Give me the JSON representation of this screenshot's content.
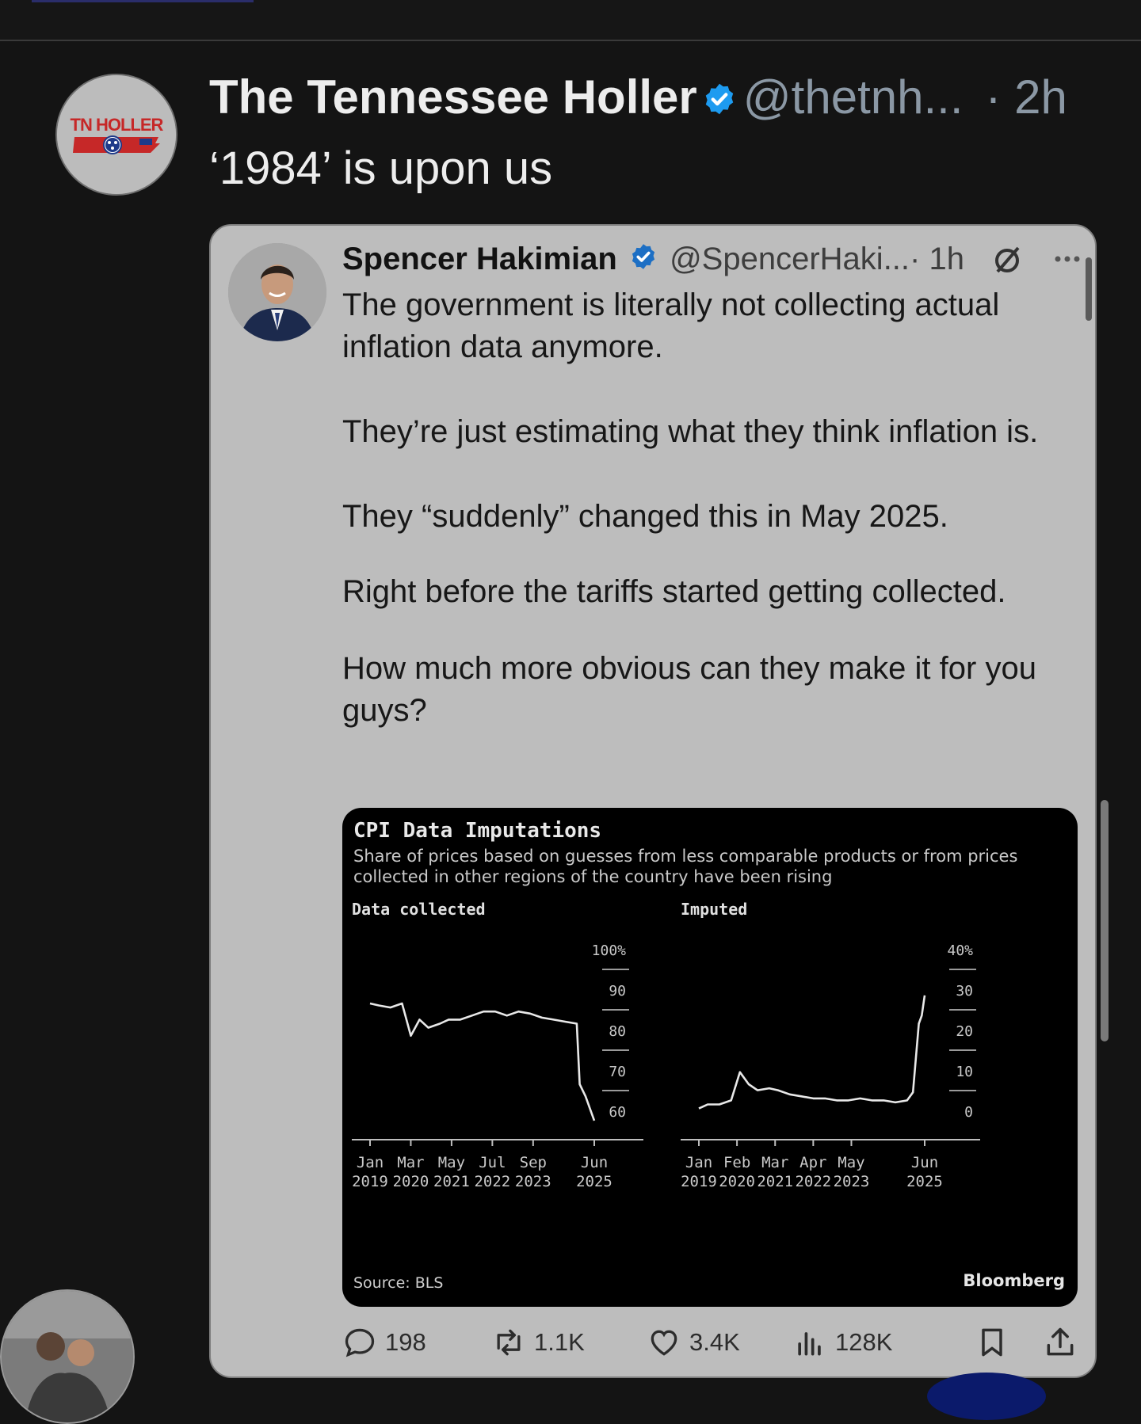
{
  "tweet": {
    "display_name": "The Tennessee Holler",
    "handle": "@thetnh...",
    "time": "· 2h",
    "text": "‘1984’ is upon us",
    "avatar_logo_text": "TN HOLLER"
  },
  "quote": {
    "display_name": "Spencer Hakimian",
    "handle": "@SpencerHaki...",
    "time": "· 1h",
    "paragraphs": [
      "The government is literally not collecting actual inflation data anymore.",
      "They’re just estimating what they think inflation is.",
      "They “suddenly” changed this in May 2025.",
      "Right before the tariffs started getting collected.",
      "How much more obvious can they make it for you guys?"
    ]
  },
  "chart": {
    "title": "CPI Data Imputations",
    "subtitle": "Share of prices based on guesses from less comparable products or from prices collected in other regions of the country have been rising",
    "source": "Source: BLS",
    "brand": "Bloomberg"
  },
  "chart_data": [
    {
      "type": "line",
      "title": "Data collected",
      "ylim": [
        60,
        100
      ],
      "yticks": [
        "100%",
        "90",
        "80",
        "70",
        "60"
      ],
      "xtick_labels": [
        "Jan 2019",
        "Mar 2020",
        "May 2021",
        "Jul 2022",
        "Sep 2023",
        "Jun 2025"
      ],
      "x": [
        "2019-01",
        "2019-04",
        "2019-08",
        "2019-12",
        "2020-03",
        "2020-06",
        "2020-09",
        "2021-01",
        "2021-04",
        "2021-08",
        "2021-12",
        "2022-04",
        "2022-08",
        "2022-12",
        "2023-04",
        "2023-08",
        "2023-12",
        "2024-04",
        "2024-08",
        "2024-12",
        "2025-01",
        "2025-03",
        "2025-05",
        "2025-06"
      ],
      "y": [
        90,
        89.5,
        89,
        90,
        82,
        86,
        84,
        85,
        86,
        86,
        87,
        88,
        88,
        87,
        88,
        87.5,
        86.5,
        86,
        85.5,
        85,
        70,
        67,
        63,
        61
      ],
      "grid": false
    },
    {
      "type": "line",
      "title": "Imputed",
      "ylim": [
        0,
        40
      ],
      "yticks": [
        "40%",
        "30",
        "20",
        "10",
        "0"
      ],
      "xtick_labels": [
        "Jan 2019",
        "Feb 2020",
        "Mar 2021",
        "Apr 2022",
        "May 2023",
        "Jun 2025"
      ],
      "x": [
        "2019-01",
        "2019-04",
        "2019-08",
        "2019-12",
        "2020-03",
        "2020-06",
        "2020-09",
        "2021-01",
        "2021-04",
        "2021-08",
        "2021-12",
        "2022-04",
        "2022-08",
        "2022-12",
        "2023-04",
        "2023-08",
        "2023-12",
        "2024-04",
        "2024-08",
        "2024-12",
        "2025-02",
        "2025-04",
        "2025-05",
        "2025-06"
      ],
      "y": [
        4,
        5,
        5,
        6,
        13,
        10,
        8.5,
        9,
        8.5,
        7.5,
        7,
        6.5,
        6.5,
        6,
        6,
        6.5,
        6,
        6,
        5.5,
        6,
        8,
        25,
        27,
        32
      ],
      "grid": false
    }
  ],
  "actions": {
    "replies": "198",
    "reposts": "1.1K",
    "likes": "3.4K",
    "views": "128K"
  },
  "colors": {
    "background": "#141414",
    "card": "#bdbdbd",
    "verified": "#1d9bf0"
  }
}
